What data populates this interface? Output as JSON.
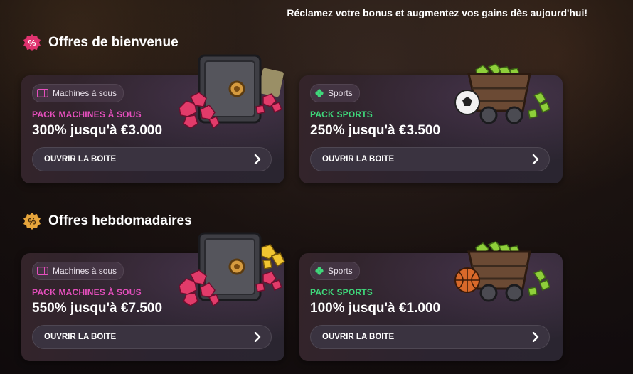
{
  "banner": "Réclamez votre bonus et augmentez vos gains dès aujourd'hui!",
  "colors": {
    "casino_accent": "#e54fbd",
    "sports_accent": "#3fd67a",
    "badge_pink": "#e0336f",
    "badge_gold": "#e6a53c"
  },
  "sections": [
    {
      "title": "Offres de bienvenue",
      "badge_icon": "percent-badge-icon",
      "cards": [
        {
          "tag": "Machines à sous",
          "tag_icon": "slot-machine-icon",
          "pack": "PACK MACHINES À SOUS",
          "amount": "300% jusqu'à €3.000",
          "button": "OUVRIR LA BOITE",
          "illustration": "safe-with-gems-icon"
        },
        {
          "tag": "Sports",
          "tag_icon": "clover-icon",
          "pack": "PACK SPORTS",
          "amount": "250% jusqu'à €3.500",
          "button": "OUVRIR LA BOITE",
          "illustration": "mine-cart-football-icon"
        }
      ]
    },
    {
      "title": "Offres hebdomadaires",
      "badge_icon": "percent-badge-icon",
      "cards": [
        {
          "tag": "Machines à sous",
          "tag_icon": "slot-machine-icon",
          "pack": "PACK MACHINES À SOUS",
          "amount": "550% jusqu'à €7.500",
          "button": "OUVRIR LA BOITE",
          "illustration": "safe-with-gems-gold-icon"
        },
        {
          "tag": "Sports",
          "tag_icon": "clover-icon",
          "pack": "PACK SPORTS",
          "amount": "100% jusqu'à €1.000",
          "button": "OUVRIR LA BOITE",
          "illustration": "mine-cart-basketball-icon"
        }
      ]
    }
  ]
}
